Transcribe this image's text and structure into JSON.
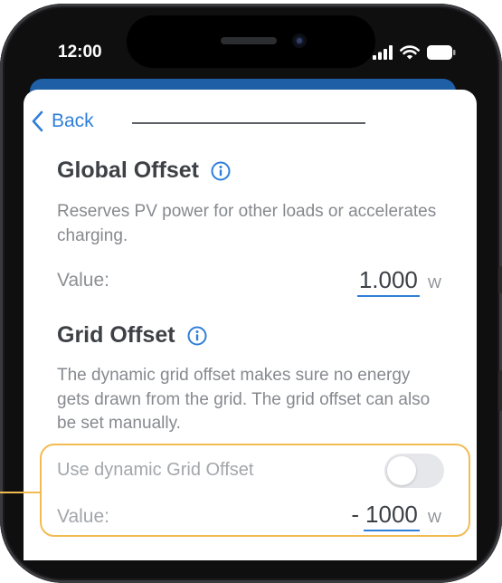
{
  "status_bar": {
    "time": "12:00",
    "icons": [
      "signal-icon",
      "wifi-icon",
      "battery-icon"
    ]
  },
  "nav": {
    "back_label": "Back"
  },
  "global_offset": {
    "title": "Global Offset",
    "description": "Reserves PV power for other loads or accelerates charging.",
    "value_label": "Value:",
    "value": "1.000",
    "unit": "W"
  },
  "grid_offset": {
    "title": "Grid Offset",
    "description": "The dynamic grid offset makes sure no energy gets drawn from the grid. The grid offset can also be set manually.",
    "toggle_label": "Use dynamic Grid Offset",
    "toggle_on": false,
    "value_label": "Value:",
    "sign": "-",
    "value": "1000",
    "unit": "W"
  },
  "colors": {
    "accent": "#2f7fd8",
    "header_blue": "#1f5fa6",
    "highlight": "#f2bb52"
  }
}
